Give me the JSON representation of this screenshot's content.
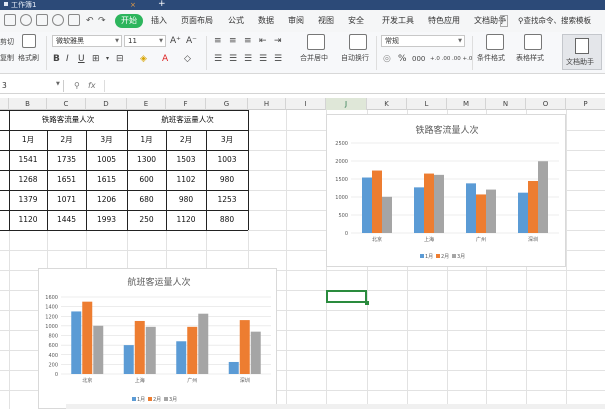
{
  "titlebar": {
    "doc_name": "工作簿1",
    "close": "×",
    "new_tab": "+"
  },
  "menubar": {
    "start": "开始",
    "items": [
      "插入",
      "页面布局",
      "公式",
      "数据",
      "审阅",
      "视图",
      "安全",
      "开发工具",
      "特色应用",
      "文档助手"
    ],
    "more": ">",
    "search": "查找命令、搜索模板"
  },
  "ribbon": {
    "cut": "剪切",
    "copy": "复制",
    "format_painter": "格式刷",
    "font_name": "微软雅黑",
    "font_size": "11",
    "font_grow": "A⁺",
    "font_shrink": "A⁻",
    "merge_center": "合并居中",
    "wrap_text": "自动换行",
    "number_format": "常规",
    "percent": "%",
    "thousands": "000",
    "dec_inc": "+.0 .00",
    "dec_dec": ".00 +.0",
    "conditional_format": "条件格式",
    "table_style": "表格样式",
    "doc_helper": "文档助手"
  },
  "formula_bar": {
    "cell_ref": "3",
    "fx": "fx",
    "value": ""
  },
  "columns": [
    "B",
    "C",
    "D",
    "E",
    "F",
    "G",
    "H",
    "I",
    "J",
    "K",
    "L",
    "M",
    "N",
    "O",
    "P"
  ],
  "selected_column": "J",
  "table": {
    "group1": "铁路客流量人次",
    "group2": "航班客运量人次",
    "months": [
      "1月",
      "2月",
      "3月"
    ],
    "rows": [
      [
        "1541",
        "1735",
        "1005",
        "1300",
        "1503",
        "1003"
      ],
      [
        "1268",
        "1651",
        "1615",
        "600",
        "1102",
        "980"
      ],
      [
        "1379",
        "1071",
        "1206",
        "680",
        "980",
        "1253"
      ],
      [
        "1120",
        "1445",
        "1993",
        "250",
        "1120",
        "880"
      ]
    ]
  },
  "chart_data": [
    {
      "type": "bar",
      "title": "铁路客流量人次",
      "categories": [
        "北京",
        "上海",
        "广州",
        "深圳"
      ],
      "series": [
        {
          "name": "1月",
          "values": [
            1541,
            1268,
            1379,
            1120
          ]
        },
        {
          "name": "2月",
          "values": [
            1735,
            1651,
            1071,
            1445
          ]
        },
        {
          "name": "3月",
          "values": [
            1005,
            1615,
            1206,
            1993
          ]
        }
      ],
      "ylim": [
        0,
        2500
      ],
      "yticks": [
        "0",
        "500",
        "1000",
        "1500",
        "2000",
        "2500"
      ],
      "colors": [
        "#5b9bd5",
        "#ed7d31",
        "#a5a5a5"
      ],
      "legend": "bottom",
      "grid": true
    },
    {
      "type": "bar",
      "title": "航班客运量人次",
      "categories": [
        "北京",
        "上海",
        "广州",
        "深圳"
      ],
      "series": [
        {
          "name": "1月",
          "values": [
            1300,
            600,
            680,
            250
          ]
        },
        {
          "name": "2月",
          "values": [
            1503,
            1102,
            980,
            1120
          ]
        },
        {
          "name": "3月",
          "values": [
            1003,
            980,
            1253,
            880
          ]
        }
      ],
      "ylim": [
        0,
        1600
      ],
      "yticks": [
        "0",
        "200",
        "400",
        "600",
        "800",
        "1000",
        "1200",
        "1400",
        "1600"
      ],
      "colors": [
        "#5b9bd5",
        "#ed7d31",
        "#a5a5a5"
      ],
      "legend": "bottom",
      "grid": true
    }
  ]
}
